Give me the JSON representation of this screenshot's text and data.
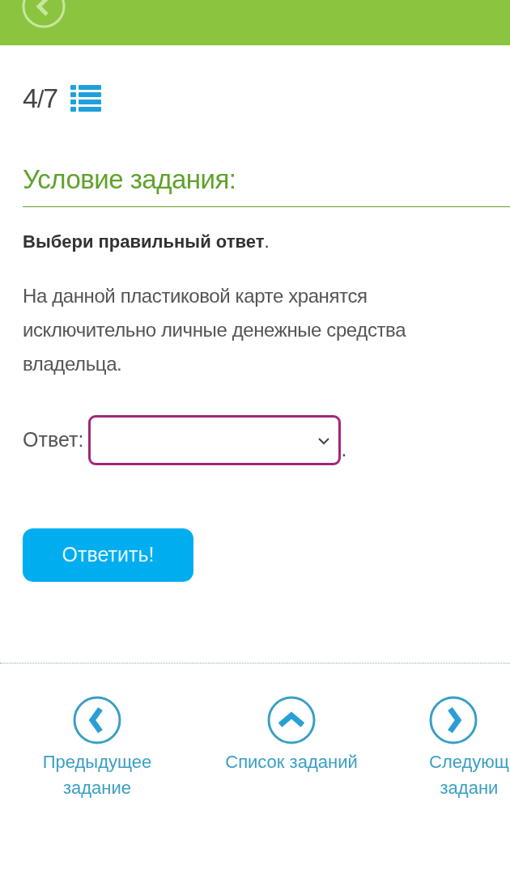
{
  "progress": {
    "current": "4",
    "separator": "/",
    "total": "7"
  },
  "section_title": "Условие задания:",
  "instruction": "**Выбери правильный ответ**.",
  "question": "На данной пластиковой карте хранятся исключительно личные денежные средства владельца.",
  "answer": {
    "label": "Ответ:",
    "trailing": "."
  },
  "submit_button": "Ответить!",
  "nav": [
    {
      "kind": "prev",
      "lines": [
        "Предыдущее",
        "задание"
      ]
    },
    {
      "kind": "list",
      "lines": [
        "Список заданий"
      ]
    },
    {
      "kind": "next",
      "lines": [
        "Следующ",
        "задани"
      ]
    }
  ]
}
